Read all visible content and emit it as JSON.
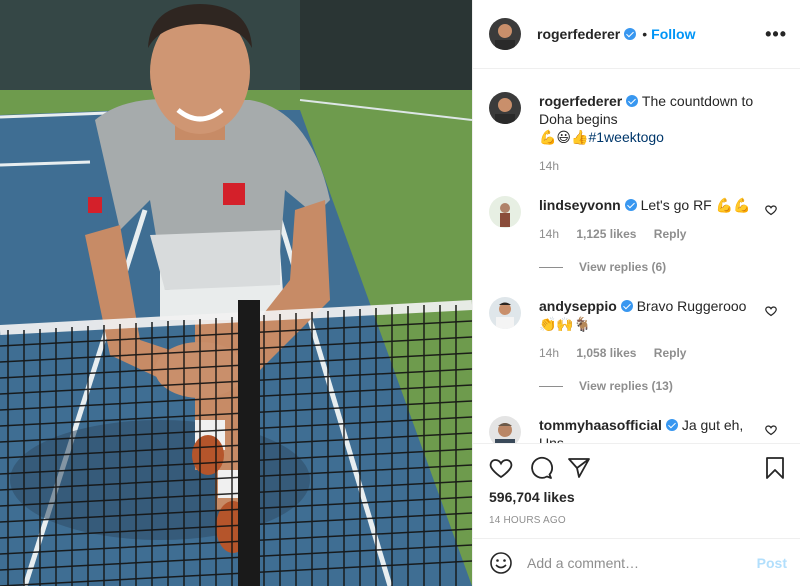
{
  "post": {
    "username": "rogerfederer",
    "follow_label": "Follow",
    "more_label": "•••",
    "dot": "•"
  },
  "caption": {
    "username": "rogerfederer",
    "text": "The countdown to Doha begins",
    "emojis": "💪😃👍",
    "hashtag": "#1weektogo",
    "time": "14h"
  },
  "comments": [
    {
      "username": "lindseyvonn",
      "text": "Let's go RF",
      "emojis": "💪💪",
      "time": "14h",
      "likes": "1,125 likes",
      "reply": "Reply",
      "view_replies": "View replies (6)"
    },
    {
      "username": "andyseppio",
      "text": "Bravo Ruggerooo",
      "emojis": "👏🙌🐐",
      "time": "14h",
      "likes": "1,058 likes",
      "reply": "Reply",
      "view_replies": "View replies (13)"
    },
    {
      "username": "tommyhaasofficial",
      "text": "Ja gut eh,",
      "second_line": "Uns…",
      "time": "",
      "likes": "",
      "reply": ""
    }
  ],
  "footer": {
    "likes": "596,704 likes",
    "posted": "14 HOURS AGO",
    "comment_placeholder": "Add a comment…",
    "post_label": "Post"
  },
  "colors": {
    "accent": "#0095f6",
    "verified": "#3897f0",
    "muted": "#8e8e8e",
    "court_blue": "#3f6e93",
    "court_green": "#6e9b4d"
  },
  "icons": [
    "heart-icon",
    "comment-icon",
    "share-icon",
    "bookmark-icon",
    "emoji-icon",
    "more-icon",
    "verified-badge-icon"
  ]
}
